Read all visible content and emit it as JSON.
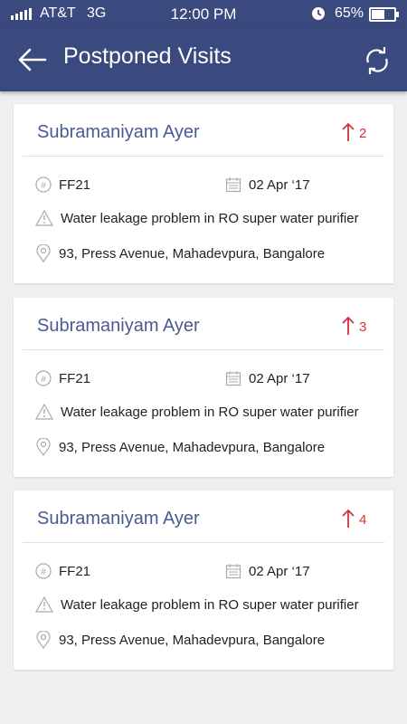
{
  "status": {
    "carrier": "AT&T",
    "network": "3G",
    "time": "12:00 PM",
    "battery": "65%",
    "battery_level": 0.65
  },
  "appbar": {
    "title": "Postponed Visits"
  },
  "visits": [
    {
      "name": "Subramaniyam Ayer",
      "count": "2",
      "code": "FF21",
      "date": "02 Apr ‘17",
      "issue": "Water leakage problem in RO super water purifier",
      "address": "93, Press Avenue, Mahadevpura, Bangalore"
    },
    {
      "name": "Subramaniyam Ayer",
      "count": "3",
      "code": "FF21",
      "date": "02 Apr ‘17",
      "issue": "Water leakage problem in RO super water purifier",
      "address": "93, Press Avenue, Mahadevpura, Bangalore"
    },
    {
      "name": "Subramaniyam Ayer",
      "count": "4",
      "code": "FF21",
      "date": "02 Apr ‘17",
      "issue": "Water leakage problem in RO super water purifier",
      "address": "93, Press Avenue, Mahadevpura, Bangalore"
    }
  ],
  "icons": {
    "back": "arrow-left-icon",
    "refresh": "refresh-icon",
    "hash": "hash-icon",
    "calendar": "calendar-icon",
    "warning": "warning-icon",
    "location": "location-pin-icon",
    "up": "arrow-up-icon"
  },
  "colors": {
    "primary": "#3b4a7e",
    "name": "#4a5a92",
    "accent": "#d0343a"
  }
}
